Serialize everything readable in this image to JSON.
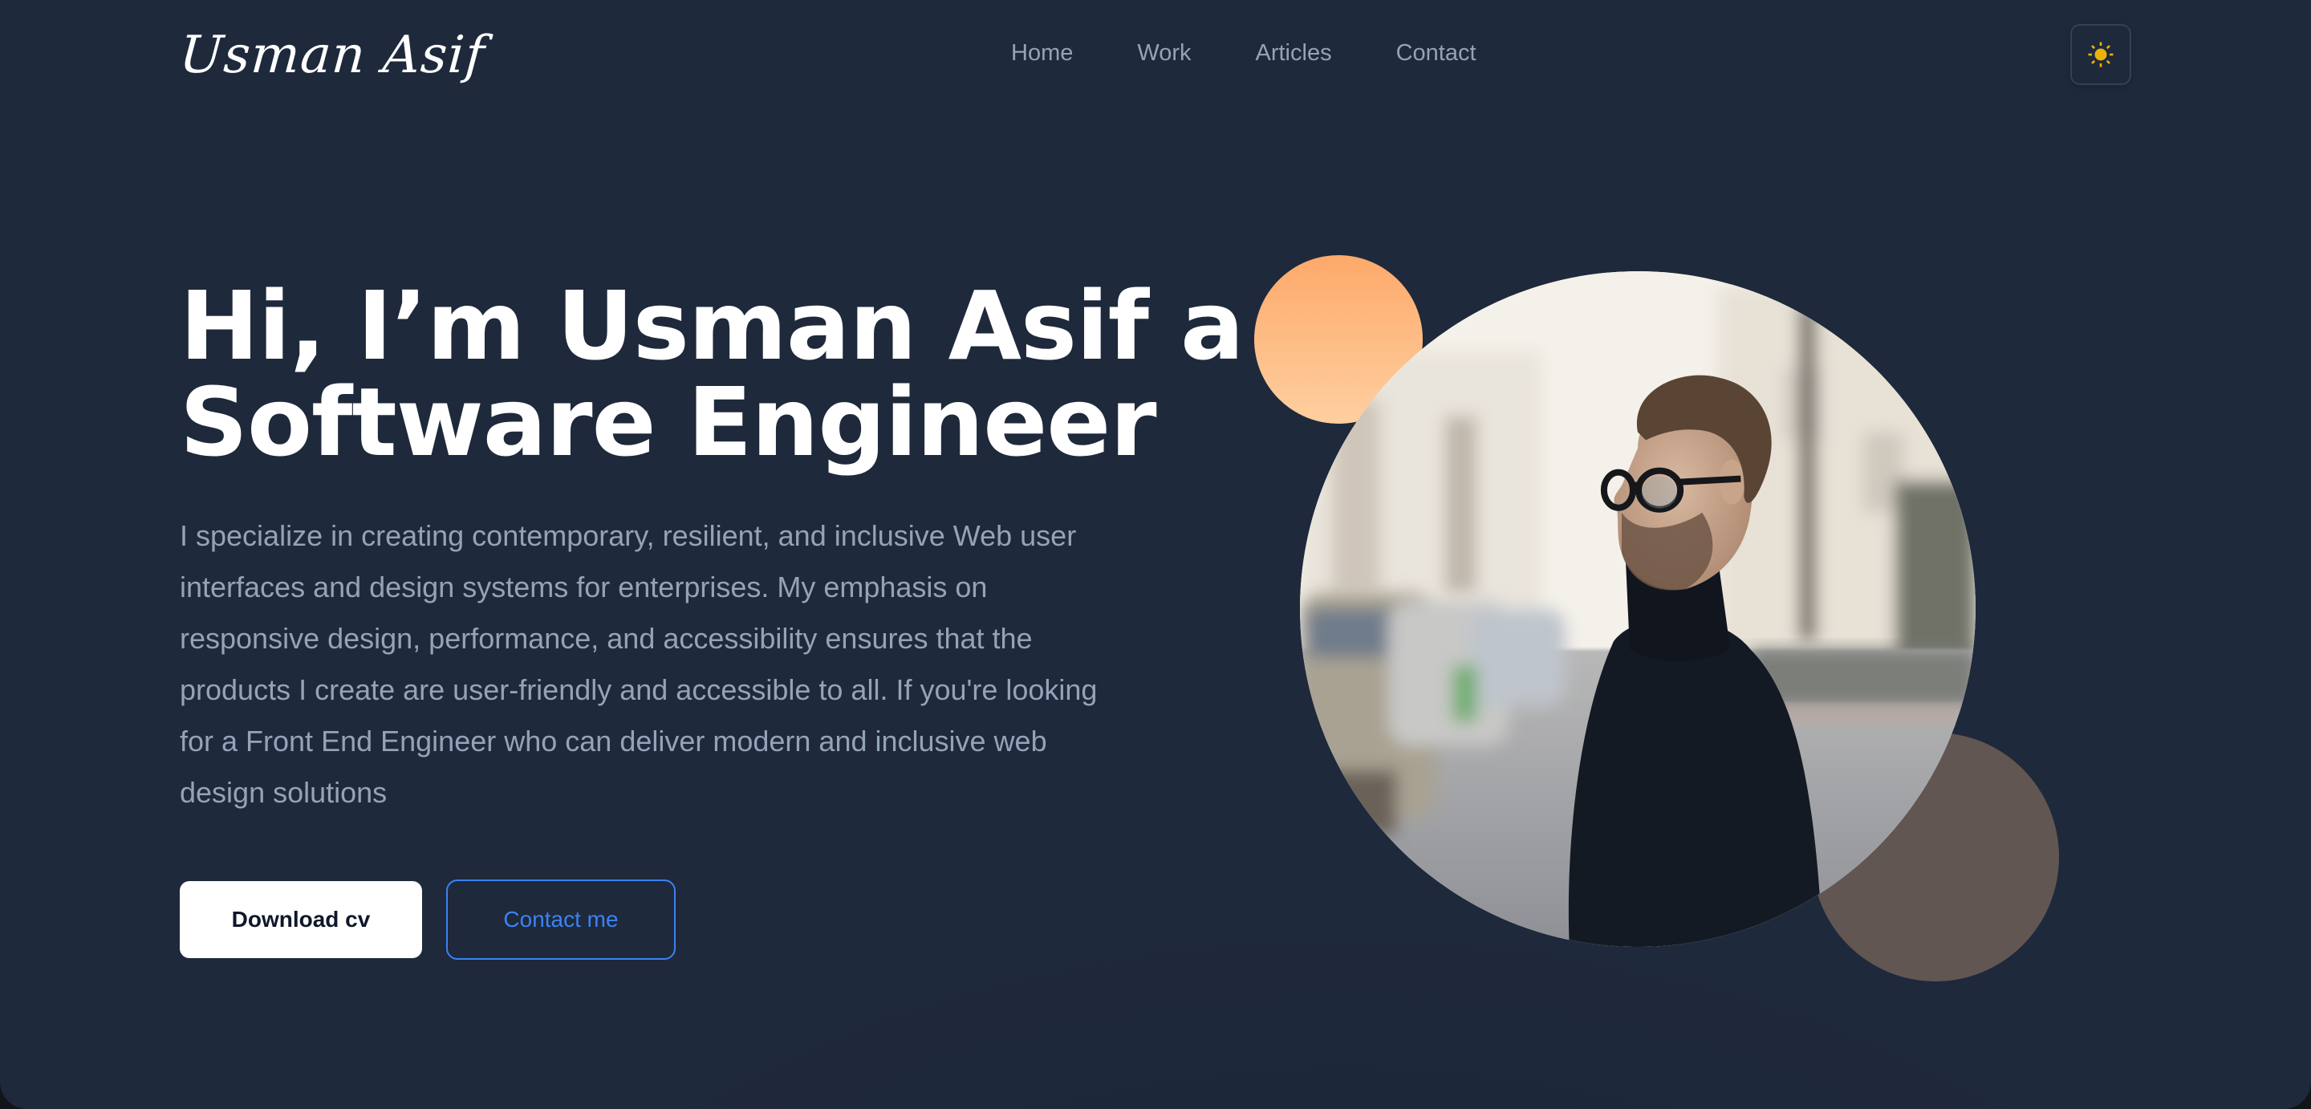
{
  "header": {
    "logo_text": "Usman Asif",
    "nav": [
      {
        "label": "Home"
      },
      {
        "label": "Work"
      },
      {
        "label": "Articles"
      },
      {
        "label": "Contact"
      }
    ],
    "theme_toggle_icon": "sun-icon",
    "theme_toggle_color": "#eab308"
  },
  "hero": {
    "headline_line1": "Hi, I’m Usman Asif a",
    "headline_line2": "Software Engineer",
    "intro": "I specialize in creating contemporary, resilient, and inclusive Web user interfaces and design systems for enterprises. My emphasis on responsive design, performance, and accessibility ensures that the products I create are user-friendly and accessible to all. If you're looking for a Front End Engineer who can deliver modern and inclusive web design solutions",
    "primary_button": "Download cv",
    "secondary_button": "Contact me"
  },
  "portrait": {
    "alt": "Portrait of a man with glasses wearing a black turtleneck on a city street"
  },
  "colors": {
    "background": "#1e293b",
    "accent": "#3b82f6",
    "muted_text": "#94a3b8",
    "orange_blob": "#fdb27a",
    "brown_blob": "#625652"
  }
}
